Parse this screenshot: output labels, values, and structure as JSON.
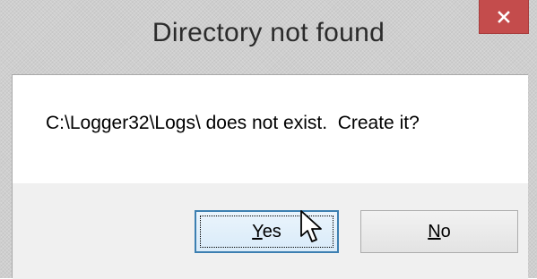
{
  "dialog": {
    "title": "Directory not found",
    "message": "C:\\Logger32\\Logs\\ does not exist.  Create it?",
    "close_icon": "close-icon"
  },
  "buttons": {
    "yes": {
      "label_prefix": "",
      "mnemonic": "Y",
      "label_rest": "es"
    },
    "no": {
      "label_prefix": "",
      "mnemonic": "N",
      "label_rest": "o"
    }
  },
  "colors": {
    "close_button": "#c44c4c",
    "focus_border": "#3c7fb1",
    "frame": "#cfcfcf"
  },
  "cursor": {
    "icon": "arrow-cursor-icon"
  }
}
